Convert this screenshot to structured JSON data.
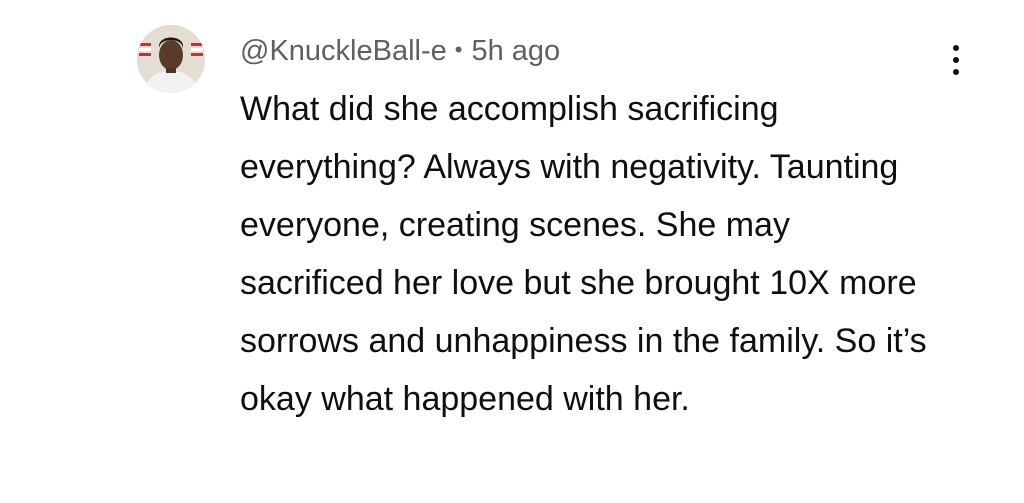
{
  "comment": {
    "author": "@KnuckleBall-e",
    "separator": "•",
    "timestamp": "5h ago",
    "text": "What did she accomplish sacrificing everything? Always with negativity. Taunting everyone, creating scenes. She may sacrificed her love but she brought 10X more sorrows and unhappiness in the family. So it’s okay what happened with her.",
    "avatar_icon": "user-avatar-photo",
    "menu_icon": "more-vertical-icon"
  }
}
